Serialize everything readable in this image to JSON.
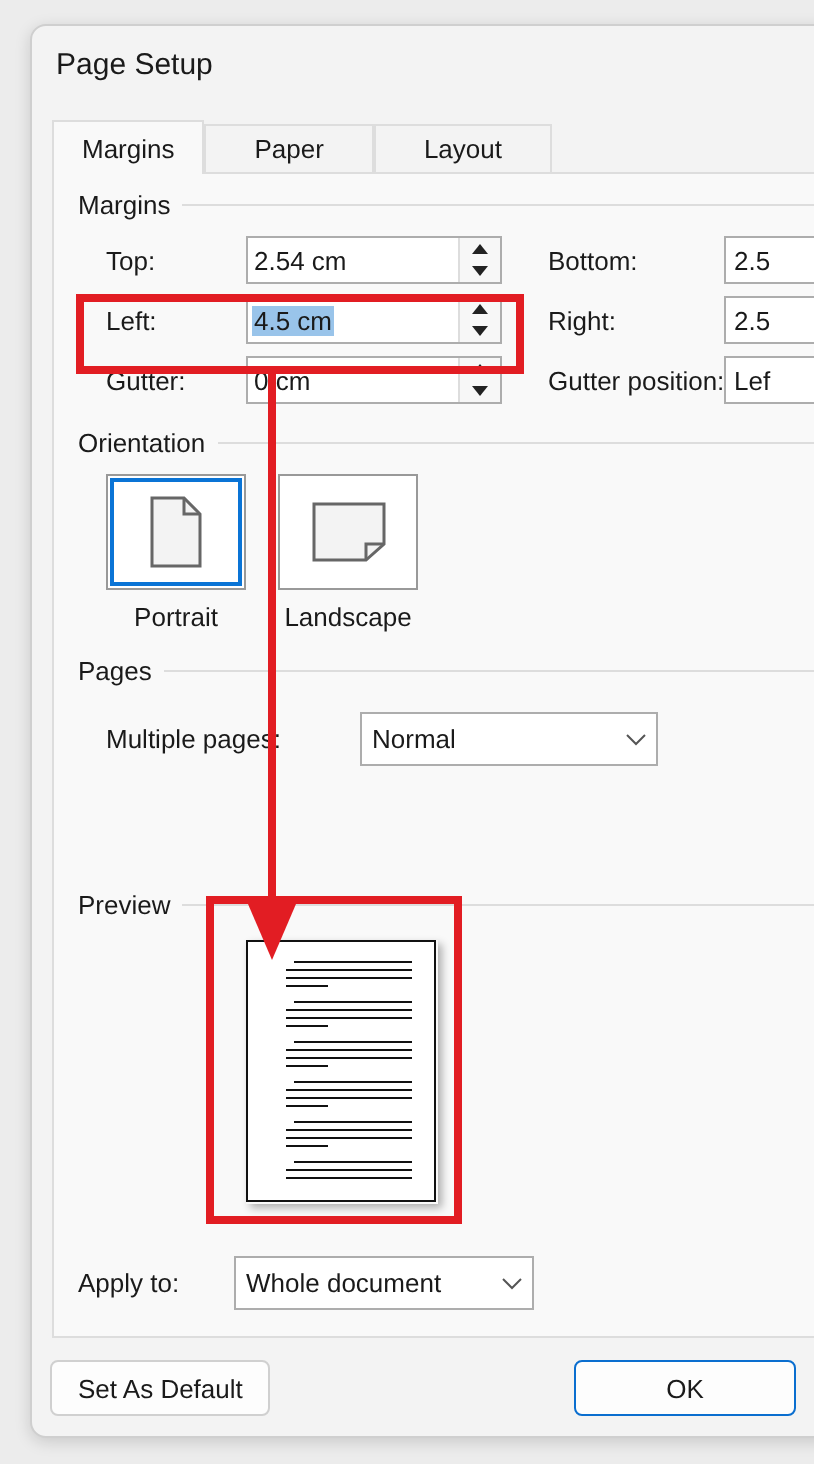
{
  "window": {
    "title": "Page Setup"
  },
  "tabs": [
    {
      "label": "Margins",
      "selected": true
    },
    {
      "label": "Paper",
      "selected": false
    },
    {
      "label": "Layout",
      "selected": false
    }
  ],
  "margins": {
    "heading": "Margins",
    "rows": [
      {
        "left": {
          "label": "Top:",
          "value": "2.54 cm",
          "text_selected": false
        },
        "right": {
          "label": "Bottom:",
          "value": "2.5"
        }
      },
      {
        "left": {
          "label": "Left:",
          "value": "4.5 cm",
          "text_selected": true
        },
        "right": {
          "label": "Right:",
          "value": "2.5"
        }
      },
      {
        "left": {
          "label": "Gutter:",
          "value": "0 cm",
          "text_selected": false
        },
        "right": {
          "label": "Gutter position:",
          "value": "Lef"
        }
      }
    ]
  },
  "orientation": {
    "heading": "Orientation",
    "options": [
      {
        "label": "Portrait",
        "kind": "portrait",
        "selected": true
      },
      {
        "label": "Landscape",
        "kind": "landscape",
        "selected": false
      }
    ]
  },
  "pages": {
    "heading": "Pages",
    "multiple_pages": {
      "label": "Multiple pages:",
      "value": "Normal"
    }
  },
  "preview": {
    "heading": "Preview"
  },
  "apply_to": {
    "label": "Apply to:",
    "value": "Whole document"
  },
  "buttons": [
    {
      "label": "Set As Default",
      "default": false
    },
    {
      "label": "OK",
      "default": true
    }
  ]
}
